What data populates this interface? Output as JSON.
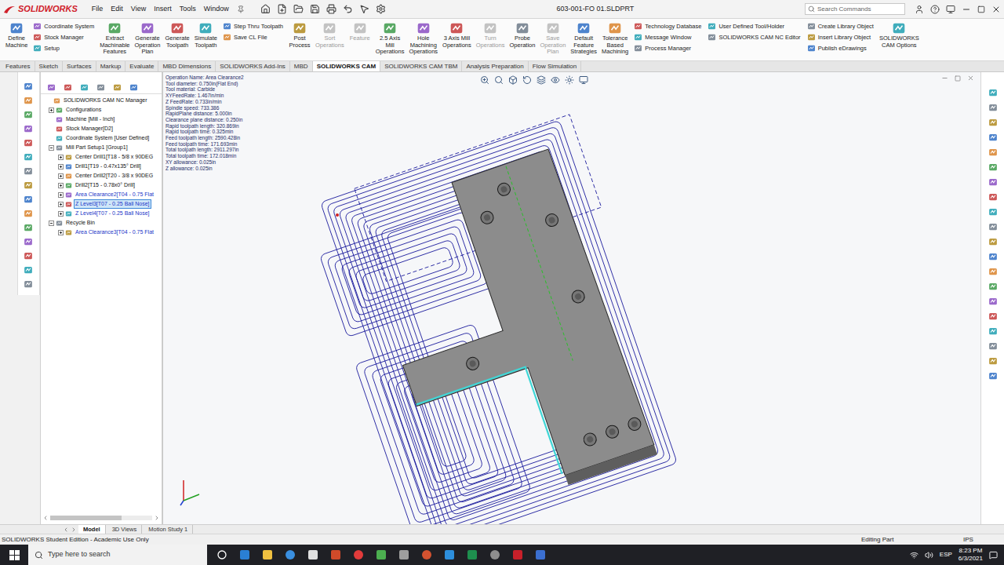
{
  "window": {
    "app": "SOLIDWORKS",
    "title": "603-001-FO 01.SLDPRT"
  },
  "menu": [
    "File",
    "Edit",
    "View",
    "Insert",
    "Tools",
    "Window"
  ],
  "search": {
    "placeholder": "Search Commands"
  },
  "ribbon": [
    {
      "kind": "big",
      "lines": [
        "Define",
        "Machine"
      ],
      "disabled": false
    },
    {
      "kind": "stack",
      "items": [
        {
          "label": "Coordinate System",
          "disabled": false
        },
        {
          "label": "Stock Manager",
          "disabled": false
        },
        {
          "label": "Setup",
          "disabled": false
        }
      ]
    },
    {
      "kind": "big",
      "lines": [
        "Extract",
        "Machinable",
        "Features"
      ],
      "disabled": false
    },
    {
      "kind": "big",
      "lines": [
        "Generate",
        "Operation",
        "Plan"
      ],
      "disabled": false
    },
    {
      "kind": "big",
      "lines": [
        "Generate",
        "Toolpath"
      ],
      "disabled": false
    },
    {
      "kind": "big",
      "lines": [
        "Simulate",
        "Toolpath"
      ],
      "disabled": false
    },
    {
      "kind": "stack",
      "items": [
        {
          "label": "Step Thru Toolpath",
          "disabled": false
        },
        {
          "label": "Save CL File",
          "disabled": false
        }
      ]
    },
    {
      "kind": "big",
      "lines": [
        "Post",
        "Process"
      ],
      "disabled": false
    },
    {
      "kind": "big",
      "lines": [
        "Sort",
        "Operations"
      ],
      "disabled": true
    },
    {
      "kind": "big",
      "lines": [
        "Feature"
      ],
      "disabled": true
    },
    {
      "kind": "big",
      "lines": [
        "2.5 Axis",
        "Mill",
        "Operations"
      ],
      "disabled": false
    },
    {
      "kind": "big",
      "lines": [
        "Hole",
        "Machining",
        "Operations"
      ],
      "disabled": false
    },
    {
      "kind": "big",
      "lines": [
        "3 Axis Mill",
        "Operations"
      ],
      "disabled": false
    },
    {
      "kind": "big",
      "lines": [
        "Turn",
        "Operations"
      ],
      "disabled": true
    },
    {
      "kind": "big",
      "lines": [
        "Probe",
        "Operation"
      ],
      "disabled": false
    },
    {
      "kind": "big",
      "lines": [
        "Save",
        "Operation",
        "Plan"
      ],
      "disabled": true
    },
    {
      "kind": "big",
      "lines": [
        "Default",
        "Feature",
        "Strategies"
      ],
      "disabled": false
    },
    {
      "kind": "big",
      "lines": [
        "Tolerance",
        "Based",
        "Machining"
      ],
      "disabled": false
    },
    {
      "kind": "stack",
      "items": [
        {
          "label": "Technology Database",
          "disabled": false
        },
        {
          "label": "Message Window",
          "disabled": false
        },
        {
          "label": "Process Manager",
          "disabled": false
        }
      ]
    },
    {
      "kind": "stack",
      "items": [
        {
          "label": "User Defined Tool/Holder",
          "disabled": false
        },
        {
          "label": "SOLIDWORKS CAM NC Editor",
          "disabled": false
        }
      ]
    },
    {
      "kind": "stack",
      "items": [
        {
          "label": "Create Library Object",
          "disabled": false
        },
        {
          "label": "Insert Library Object",
          "disabled": false
        },
        {
          "label": "Publish eDrawings",
          "disabled": false
        }
      ]
    },
    {
      "kind": "big",
      "lines": [
        "SOLIDWORKS",
        "CAM Options"
      ],
      "disabled": false
    }
  ],
  "ribbon_tabs": [
    {
      "label": "Features",
      "selected": false
    },
    {
      "label": "Sketch",
      "selected": false
    },
    {
      "label": "Surfaces",
      "selected": false
    },
    {
      "label": "Markup",
      "selected": false
    },
    {
      "label": "Evaluate",
      "selected": false
    },
    {
      "label": "MBD Dimensions",
      "selected": false
    },
    {
      "label": "SOLIDWORKS Add-Ins",
      "selected": false
    },
    {
      "label": "MBD",
      "selected": false
    },
    {
      "label": "SOLIDWORKS CAM",
      "selected": true
    },
    {
      "label": "SOLIDWORKS CAM TBM",
      "selected": false
    },
    {
      "label": "Analysis Preparation",
      "selected": false
    },
    {
      "label": "Flow Simulation",
      "selected": false
    }
  ],
  "tree": [
    {
      "label": "SOLIDWORKS CAM NC Manager",
      "level": 0,
      "expandable": false,
      "expanded": false,
      "selected": false,
      "color": "#111111"
    },
    {
      "label": "Configurations",
      "level": 1,
      "expandable": true,
      "expanded": false,
      "selected": false,
      "color": "#111111"
    },
    {
      "label": "Machine [Mill - Inch]",
      "level": 1,
      "expandable": false,
      "expanded": false,
      "selected": false,
      "color": "#111111"
    },
    {
      "label": "Stock Manager[D2]",
      "level": 1,
      "expandable": false,
      "expanded": false,
      "selected": false,
      "color": "#111111"
    },
    {
      "label": "Coordinate System [User Defined]",
      "level": 1,
      "expandable": false,
      "expanded": false,
      "selected": false,
      "color": "#111111"
    },
    {
      "label": "Mill Part Setup1 [Group1]",
      "level": 1,
      "expandable": true,
      "expanded": true,
      "selected": false,
      "color": "#111111"
    },
    {
      "label": "Center Drill1[T18 - 5/8 x 90DEG",
      "level": 2,
      "expandable": true,
      "expanded": false,
      "selected": false,
      "color": "#111111"
    },
    {
      "label": "Drill1[T19 - 0.47x135° Drill]",
      "level": 2,
      "expandable": true,
      "expanded": false,
      "selected": false,
      "color": "#111111"
    },
    {
      "label": "Center Drill2[T20 - 3/8 x 90DEG",
      "level": 2,
      "expandable": true,
      "expanded": false,
      "selected": false,
      "color": "#111111"
    },
    {
      "label": "Drill2[T15 - 0.78x0° Drill]",
      "level": 2,
      "expandable": true,
      "expanded": false,
      "selected": false,
      "color": "#111111"
    },
    {
      "label": "Area Clearance2[T04 - 0.75 Flat",
      "level": 2,
      "expandable": true,
      "expanded": false,
      "selected": false,
      "color": "#1a35c8"
    },
    {
      "label": "Z Level3[T07 - 0.25 Ball Nose]",
      "level": 2,
      "expandable": true,
      "expanded": false,
      "selected": true,
      "color": "#1a35c8"
    },
    {
      "label": "Z Level4[T07 - 0.25 Ball Nose]",
      "level": 2,
      "expandable": true,
      "expanded": false,
      "selected": false,
      "color": "#1a35c8"
    },
    {
      "label": "Recycle Bin",
      "level": 1,
      "expandable": true,
      "expanded": true,
      "selected": false,
      "color": "#111111"
    },
    {
      "label": "Area Clearance3[T04 - 0.75 Flat",
      "level": 2,
      "expandable": true,
      "expanded": false,
      "selected": false,
      "color": "#1a35c8"
    }
  ],
  "info": [
    "Operation Name: Area Clearance2",
    "Tool diameter: 0.750in(Flat End)",
    "Tool material: Carbide",
    "XYFeedRate: 1.467in/min",
    "Z FeedRate: 0.733in/min",
    "Spindle speed: 733.386",
    "RapidPlane distance: 5.000in",
    "Clearance plane distance: 0.250in",
    "Rapid toolpath length: 320.869in",
    "Rapid toolpath time: 0.325min",
    "Feed toolpath length: 2590.428in",
    "Feed toolpath time: 171.693min",
    "Total toolpath length: 2911.297in",
    "Total toolpath time: 172.018min",
    "XY allowance: 0.025in",
    "Z allowance: 0.025in"
  ],
  "bottom_tabs": [
    {
      "label": "Model",
      "selected": true
    },
    {
      "label": "3D Views",
      "selected": false
    },
    {
      "label": "Motion Study 1",
      "selected": false
    }
  ],
  "status": {
    "left": "SOLIDWORKS Student Edition - Academic Use Only",
    "mode": "Editing Part",
    "units": "IPS"
  },
  "taskbar": {
    "search": "Type here to search",
    "time": "8:23 PM",
    "date": "6/3/2021",
    "lang": "ESP"
  }
}
